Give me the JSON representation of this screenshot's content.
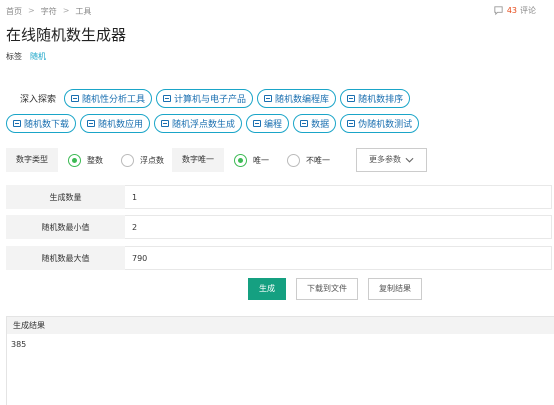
{
  "breadcrumb": {
    "home": "首页",
    "sep": ">",
    "category": "字符",
    "section": "工具"
  },
  "comments": {
    "count": "43",
    "label": "评论"
  },
  "title": "在线随机数生成器",
  "tags": {
    "label": "标签",
    "items": [
      "随机"
    ]
  },
  "explore": {
    "label": "深入探索",
    "row1": [
      "随机性分析工具",
      "计算机与电子产品",
      "随机数编程库",
      "随机数排序"
    ],
    "row2": [
      "随机数下载",
      "随机数应用",
      "随机浮点数生成",
      "编程",
      "数据",
      "伪随机数测试"
    ]
  },
  "options": {
    "type_label": "数字类型",
    "type_int": "整数",
    "type_float": "浮点数",
    "unique_label": "数字唯一",
    "unique_yes": "唯一",
    "unique_no": "不唯一",
    "more": "更多参数"
  },
  "fields": {
    "count_label": "生成数量",
    "count_value": "1",
    "min_label": "随机数最小值",
    "min_value": "2",
    "max_label": "随机数最大值",
    "max_value": "790"
  },
  "actions": {
    "generate": "生成",
    "download": "下载到文件",
    "copy": "复制结果"
  },
  "result": {
    "header": "生成结果",
    "value": "385"
  },
  "colors": {
    "accent": "#15a081",
    "radio": "#3cba54",
    "link": "#1aa5c8",
    "comment_count": "#e64a19"
  }
}
